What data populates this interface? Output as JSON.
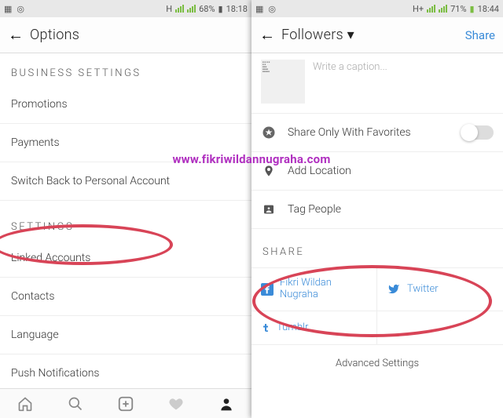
{
  "left": {
    "status": {
      "battery": "68%",
      "time": "18:18",
      "net": "H"
    },
    "header": {
      "title": "Options"
    },
    "section1": "BUSINESS SETTINGS",
    "items1": [
      "Promotions",
      "Payments",
      "Switch Back to Personal Account"
    ],
    "section2": "SETTINGS",
    "items2": [
      "Linked Accounts",
      "Contacts",
      "Language",
      "Push Notifications"
    ]
  },
  "right": {
    "status": {
      "battery": "71%",
      "time": "18:44",
      "net": "H+"
    },
    "header": {
      "title": "Followers ▾",
      "action": "Share"
    },
    "caption_placeholder": "Write a caption...",
    "rows": {
      "favorites": "Share Only With Favorites",
      "location": "Add Location",
      "tag": "Tag People"
    },
    "share_section": "SHARE",
    "accounts": {
      "fb": "Fikri Wildan Nugraha",
      "tw": "Twitter",
      "tb": "Tumblr"
    },
    "advanced": "Advanced Settings"
  },
  "watermark": "www.fikriwildannugraha.com"
}
